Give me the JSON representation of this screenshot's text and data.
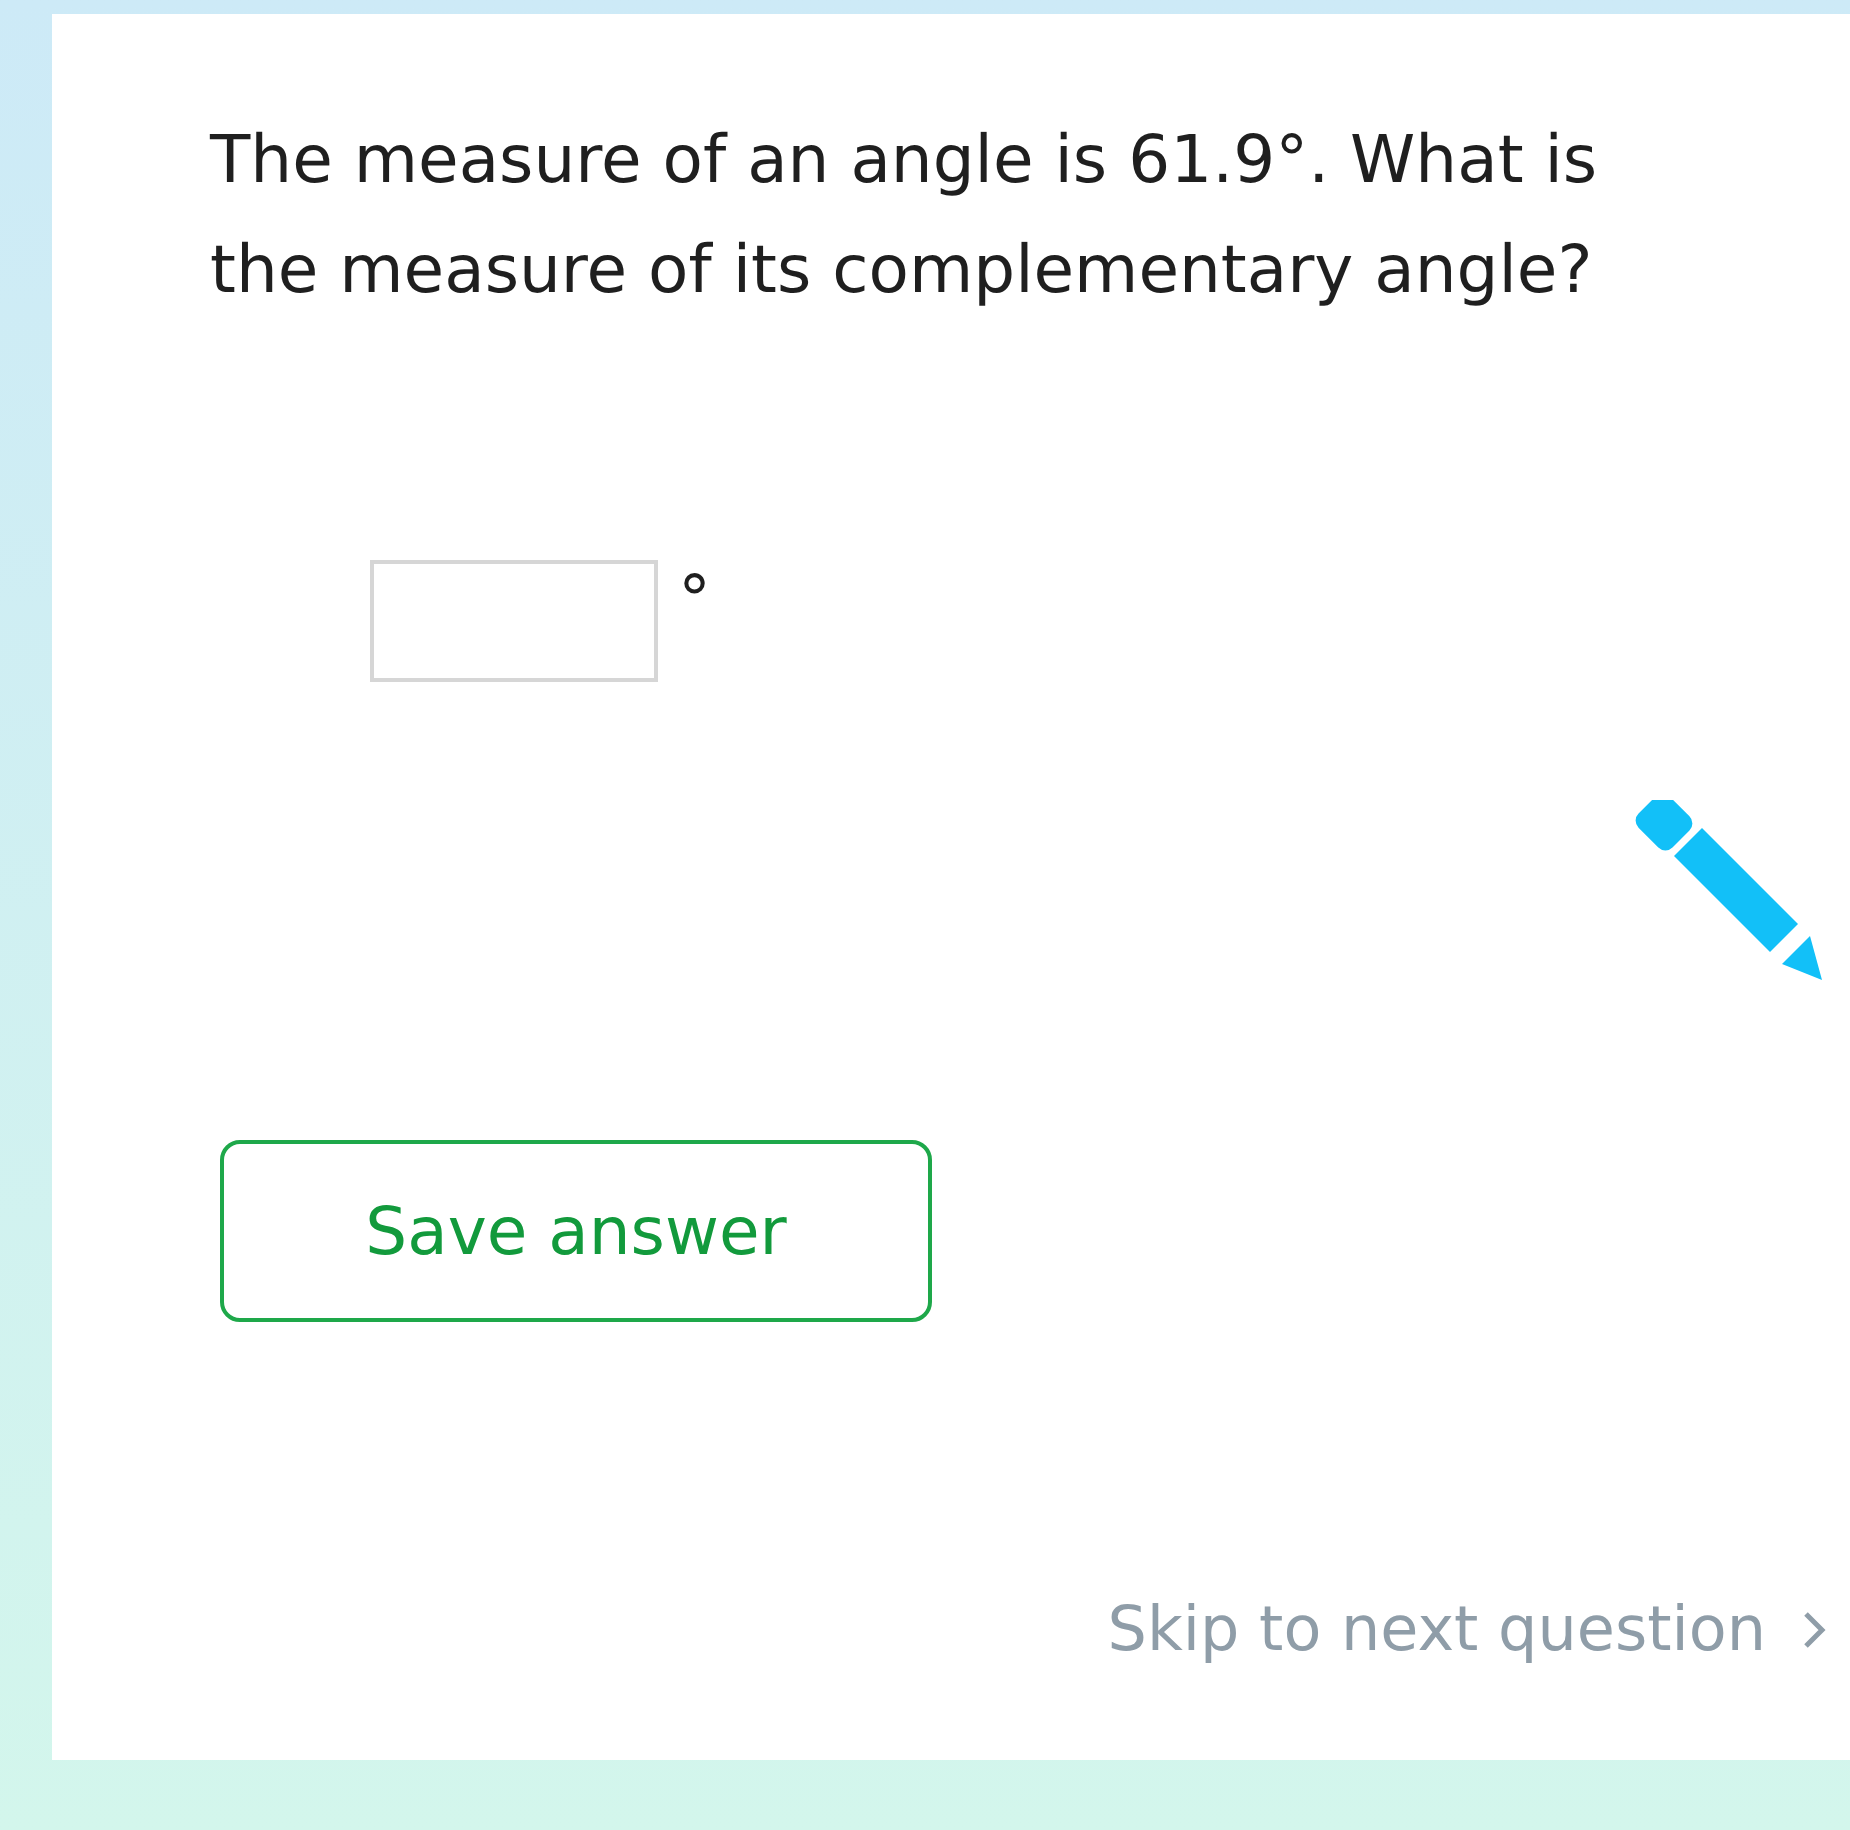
{
  "question": "The measure of an angle is 61.9°. What is the measure of its complementary angle?",
  "answer": {
    "unit": "°"
  },
  "save_button": "Save answer",
  "skip_link": "Skip to next question"
}
